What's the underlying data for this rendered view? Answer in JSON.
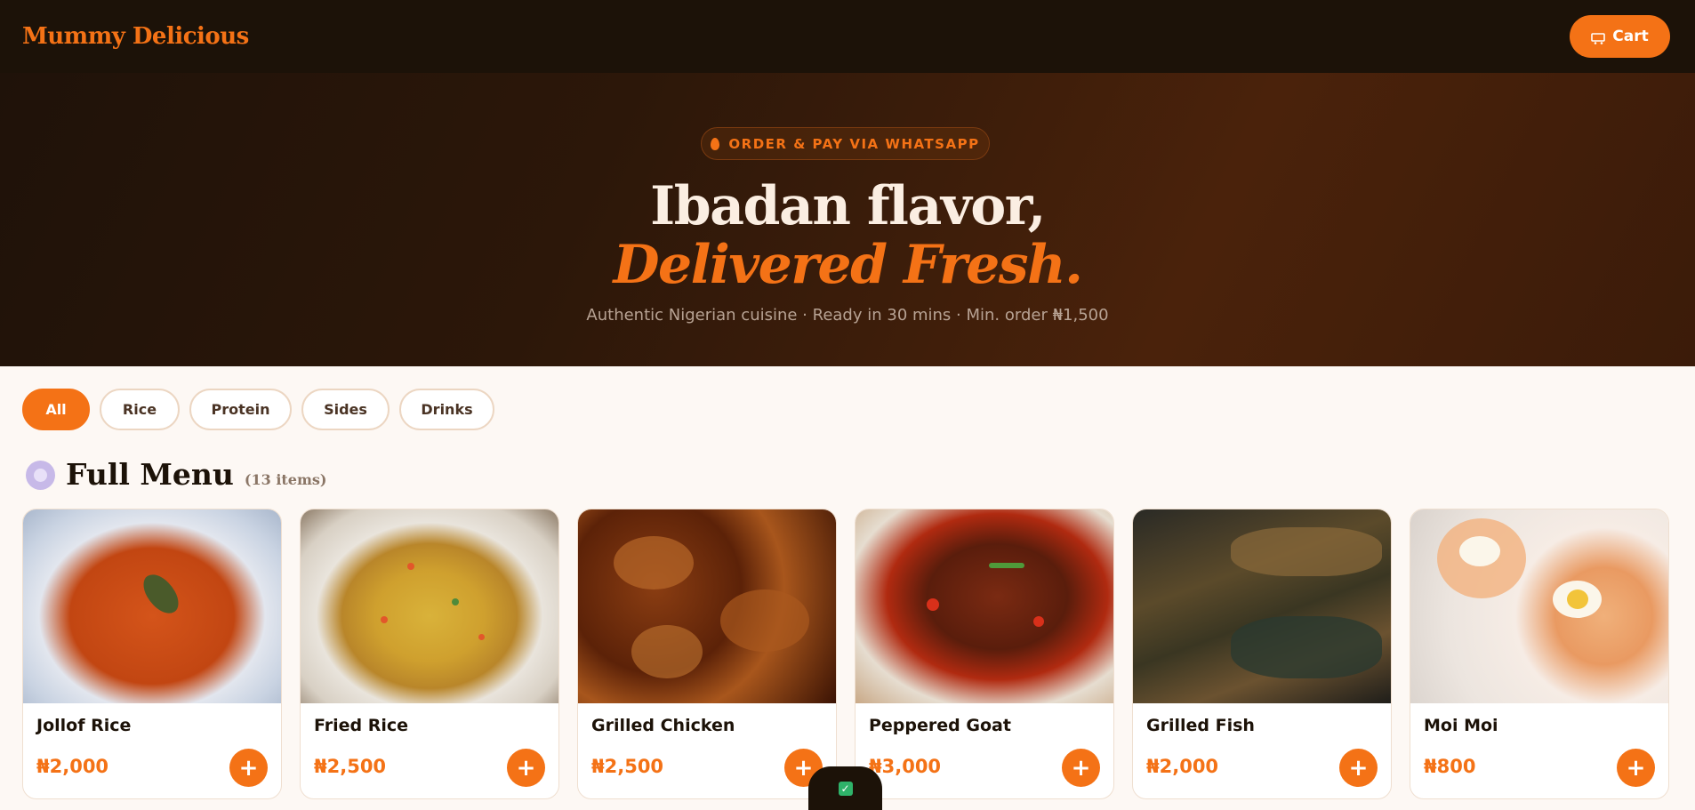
{
  "brand": {
    "name": "Mummy Delicious"
  },
  "header": {
    "cart_label": "Cart",
    "cart_icon": "cart-icon"
  },
  "hero": {
    "badge": "ORDER & PAY VIA WHATSAPP",
    "badge_icon": "flame-icon",
    "title_line1": "Ibadan flavor,",
    "title_line2": "Delivered Fresh.",
    "subtitle": "Authentic Nigerian cuisine · Ready in 30 mins · Min. order ₦1,500"
  },
  "filters": [
    {
      "label": "All",
      "active": true
    },
    {
      "label": "Rice",
      "active": false
    },
    {
      "label": "Protein",
      "active": false
    },
    {
      "label": "Sides",
      "active": false
    },
    {
      "label": "Drinks",
      "active": false
    }
  ],
  "menu": {
    "icon": "plate-icon",
    "title": "Full Menu",
    "count": "(13 items)",
    "items": [
      {
        "name": "Jollof Rice",
        "price": "₦2,000",
        "add": "+"
      },
      {
        "name": "Fried Rice",
        "price": "₦2,500",
        "add": "+"
      },
      {
        "name": "Grilled Chicken",
        "price": "₦2,500",
        "add": "+"
      },
      {
        "name": "Peppered Goat",
        "price": "₦3,000",
        "add": "+"
      },
      {
        "name": "Grilled Fish",
        "price": "₦2,000",
        "add": "+"
      },
      {
        "name": "Moi Moi",
        "price": "₦800",
        "add": "+"
      }
    ]
  },
  "toast": {
    "icon": "check-icon",
    "symbol": "✓"
  },
  "colors": {
    "accent": "#f47216",
    "dark": "#1c1208",
    "background": "#fdf8f4"
  }
}
